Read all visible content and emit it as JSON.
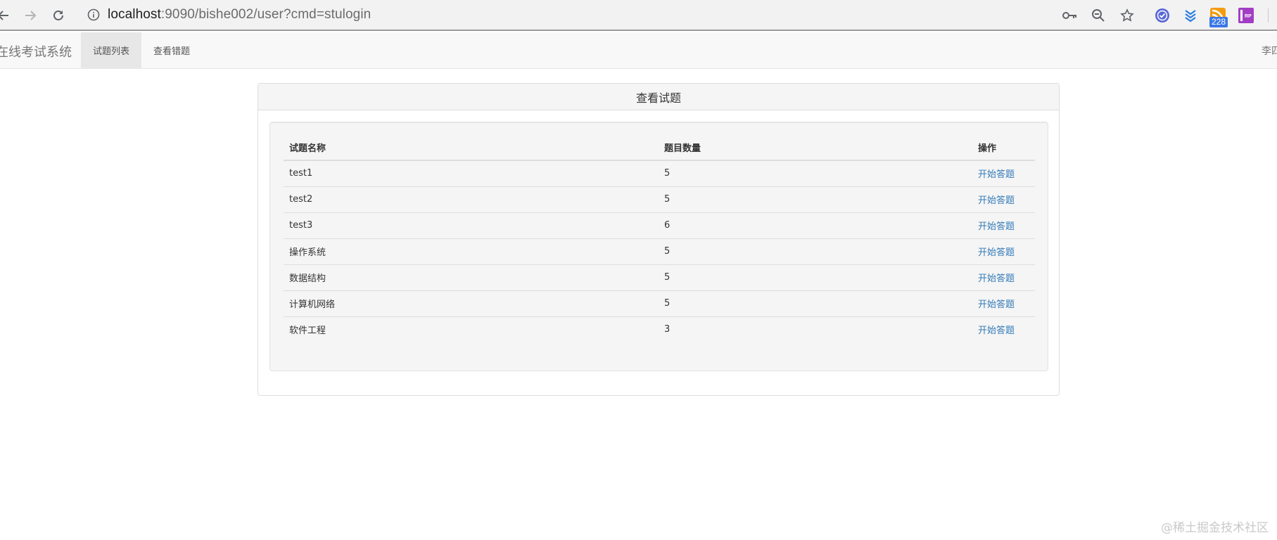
{
  "browser": {
    "url_host": "localhost",
    "url_rest": ":9090/bishe002/user?cmd=stulogin",
    "extension_badge": "228",
    "extension_rp_label": "RP"
  },
  "navbar": {
    "brand": "在线考试系统",
    "items": [
      {
        "label": "试题列表",
        "active": true
      },
      {
        "label": "查看错题",
        "active": false
      }
    ],
    "user": "李四"
  },
  "panel": {
    "title": "查看试题"
  },
  "table": {
    "headers": [
      "试题名称",
      "题目数量",
      "操作"
    ],
    "rows": [
      {
        "name": "test1",
        "count": "5",
        "action": "开始答题"
      },
      {
        "name": "test2",
        "count": "5",
        "action": "开始答题"
      },
      {
        "name": "test3",
        "count": "6",
        "action": "开始答题"
      },
      {
        "name": "操作系统",
        "count": "5",
        "action": "开始答题"
      },
      {
        "name": "数据结构",
        "count": "5",
        "action": "开始答题"
      },
      {
        "name": "计算机网络",
        "count": "5",
        "action": "开始答题"
      },
      {
        "name": "软件工程",
        "count": "3",
        "action": "开始答题"
      }
    ]
  },
  "watermark": "@稀土掘金技术社区",
  "colors": {
    "link": "#337ab7",
    "navbar_bg": "#f8f8f8",
    "active_nav_bg": "#e7e7e7",
    "well_bg": "#f5f5f5"
  }
}
